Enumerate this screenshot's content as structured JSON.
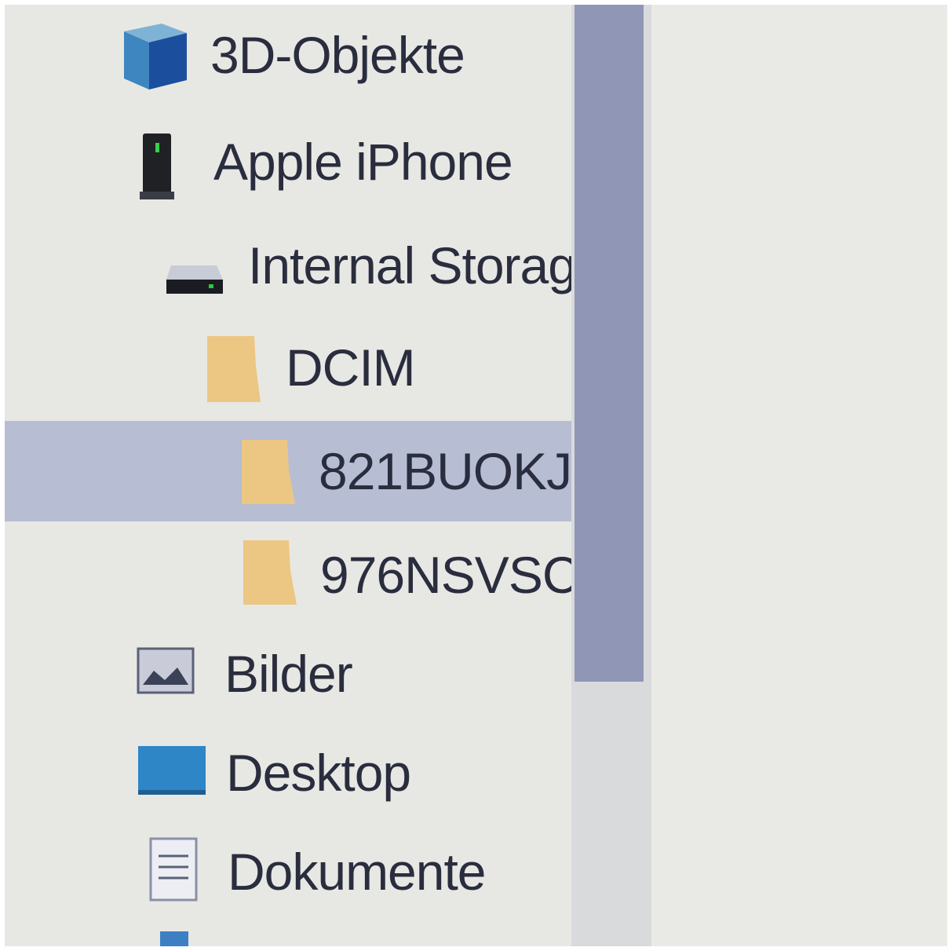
{
  "nav": {
    "items": [
      {
        "label": "3D-Objekte",
        "icon": "cube-icon"
      },
      {
        "label": "Apple iPhone",
        "icon": "phone-icon"
      },
      {
        "label": "Internal Storag",
        "icon": "drive-icon"
      },
      {
        "label": "DCIM",
        "icon": "folder-icon"
      },
      {
        "label": "821BUOKJ",
        "icon": "folder-icon",
        "selected": true
      },
      {
        "label": "976NSVSC",
        "icon": "folder-icon"
      },
      {
        "label": "Bilder",
        "icon": "pictures-icon"
      },
      {
        "label": "Desktop",
        "icon": "desktop-icon"
      },
      {
        "label": "Dokumente",
        "icon": "documents-icon"
      }
    ]
  },
  "colors": {
    "selection": "#b7bdd3",
    "scrollbar_thumb": "#8f96b6",
    "folder": "#ecc784",
    "text": "#2a2d3e"
  }
}
